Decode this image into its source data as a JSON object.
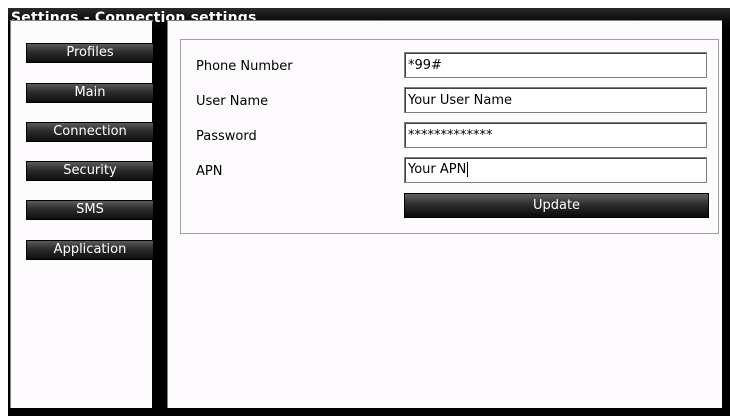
{
  "window": {
    "title": "Settings - Connection settings"
  },
  "sidebar": {
    "items": [
      {
        "label": "Profiles"
      },
      {
        "label": "Main"
      },
      {
        "label": "Connection"
      },
      {
        "label": "Security"
      },
      {
        "label": "SMS"
      },
      {
        "label": "Application"
      }
    ]
  },
  "form": {
    "phone_number": {
      "label": "Phone Number",
      "value": "*99#"
    },
    "user_name": {
      "label": "User Name",
      "value": "Your User Name"
    },
    "password": {
      "label": "Password",
      "value": "*************"
    },
    "apn": {
      "label": "APN",
      "value": "Your APN"
    },
    "update_label": "Update"
  }
}
